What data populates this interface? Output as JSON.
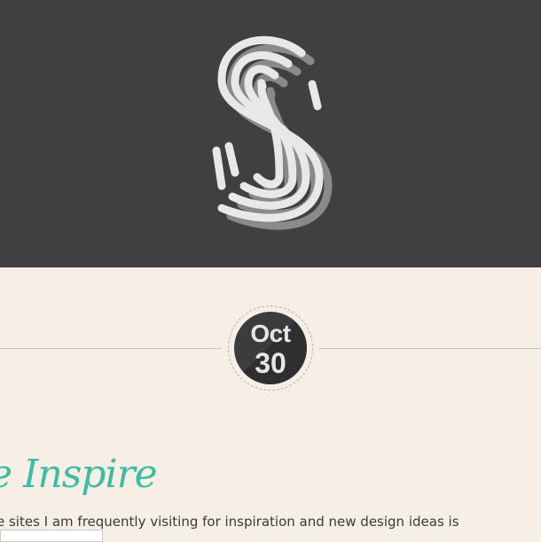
{
  "hero": {
    "logo_icon": "fingerprint-s-logo-icon",
    "colors": {
      "background": "#404042",
      "logo": "#e6e6e6",
      "logo_shadow": "#8a8a8c"
    }
  },
  "date_badge": {
    "month": "Oct",
    "day": "30"
  },
  "post": {
    "title": "e Inspire",
    "excerpt": "e sites I am frequently visiting for inspiration and new design ideas is"
  },
  "colors": {
    "page": "#f5efe5",
    "accent": "#3dbba3",
    "rule": "#c9c7b2"
  }
}
